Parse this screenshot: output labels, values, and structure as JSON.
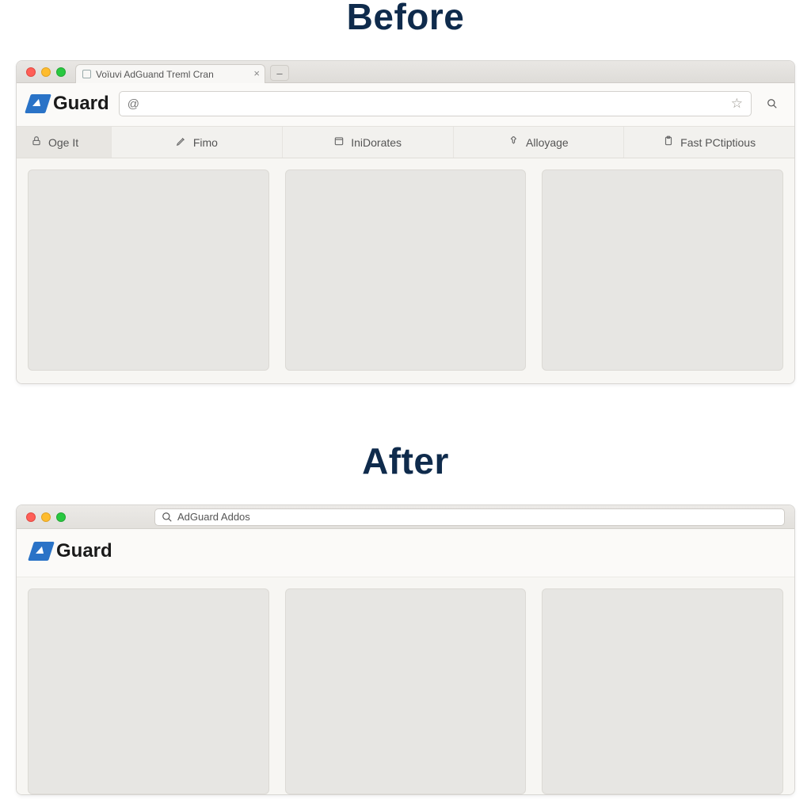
{
  "headings": {
    "before": "Before",
    "after": "After"
  },
  "brand": {
    "name": "Guard"
  },
  "before_window": {
    "tab_title": "Voïuvi AdGuand Treml Cran",
    "url_leading_glyph": "@",
    "navtabs": [
      {
        "icon": "lock-icon",
        "label": "Oge It"
      },
      {
        "icon": "pen-icon",
        "label": "Fimo"
      },
      {
        "icon": "calendar-icon",
        "label": "IniDorates"
      },
      {
        "icon": "pin-icon",
        "label": "Alloyage"
      },
      {
        "icon": "clipboard-icon",
        "label": "Fast PCtiptious"
      }
    ]
  },
  "after_window": {
    "search_text": "AdGuard Addos"
  }
}
